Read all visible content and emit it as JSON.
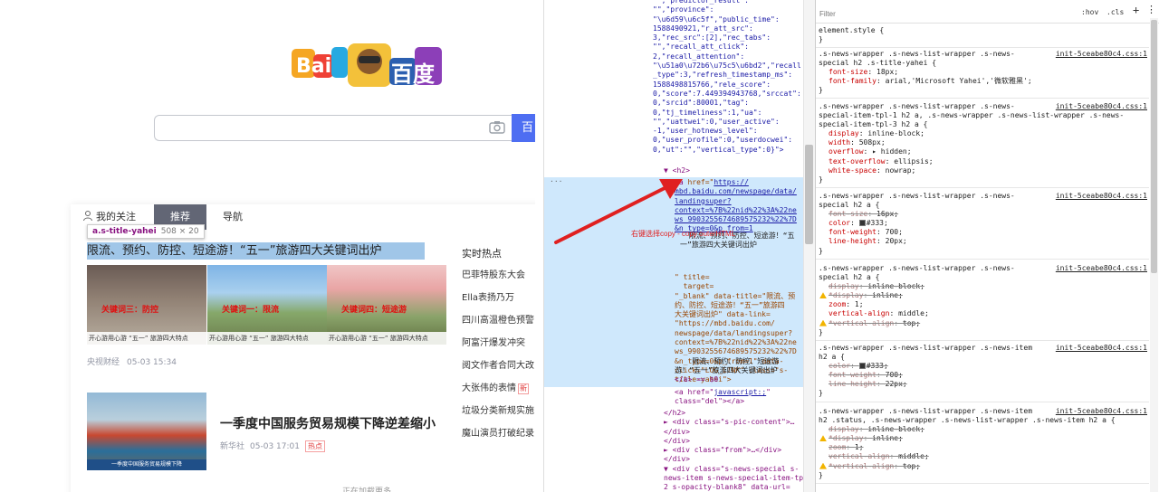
{
  "page": {
    "logo_text": "百度",
    "logo_prefix": "Bai",
    "search": {
      "placeholder": "",
      "button_label": "百"
    },
    "tabs": [
      {
        "label": "我的关注"
      },
      {
        "label": "推荐"
      },
      {
        "label": "导航"
      }
    ],
    "inspect_tooltip": {
      "selector": "a.s-title-yahei",
      "size": "508 × 20"
    },
    "news1": {
      "title": "限流、预约、防控、短途游！“五一”旅游四大关键词出炉",
      "thumbs": [
        {
          "caption": "开心游用心游 “五一” 旅游四大特点",
          "overlay": "关键词三：防控"
        },
        {
          "caption": "开心游用心游 “五一” 旅游四大特点",
          "overlay": "关键词一：限流"
        },
        {
          "caption": "开心游用心游 “五一” 旅游四大特点",
          "overlay": "关键词四：短途游"
        }
      ],
      "source": "央视财经",
      "time": "05-03 15:34"
    },
    "news2": {
      "title": "一季度中国服务贸易规模下降逆差缩小",
      "image_caption": "一季度中国服务贸易规模下降",
      "source": "新华社",
      "time": "05-03 17:01",
      "badge": "热点"
    },
    "hot": {
      "title": "实时热点",
      "items": [
        {
          "label": "巴菲特股东大会",
          "tag": ""
        },
        {
          "label": "Ella表扬乃万",
          "tag": ""
        },
        {
          "label": "四川高温橙色预警",
          "tag": ""
        },
        {
          "label": "阿富汗爆发冲突",
          "tag": ""
        },
        {
          "label": "阅文作者合同大改",
          "tag": ""
        },
        {
          "label": "大张伟的表情",
          "tag": "新"
        },
        {
          "label": "垃圾分类新规实施",
          "tag": ""
        },
        {
          "label": "魔山演员打破纪录",
          "tag": ""
        }
      ]
    },
    "bottom_more": "正在加载更多"
  },
  "elements": {
    "json_top": "  ,\"predictor_result\":\n\"\",\"province\":\n\"\\u6d59\\u6c5f\",\"public_time\":\n1588490921,\"r_att_src\":\n3,\"rec_src\":[2],\"rec_tabs\":\n\"\",\"recall_att_click\":\n2,\"recall_attention\":\n\"\\u51a0\\u72b6\\u75c5\\u6bd2\",\"recall\n_type\":3,\"refresh_timestamp_ms\":\n1588498815766,\"rele_score\":\n0,\"score\":7.449394943768,\"srccat\":\n0,\"srcid\":80001,\"tag\":\n0,\"tj_timeliness\":1,\"ua\":\n\"\",\"uattwei\":0,\"user_active\":\n-1,\"user_hotnews_level\":\n0,\"user_profile\":0,\"userdocwei\":\n0,\"ut\":\"\",\"vertical_type\":0}\">",
    "h2_open": "▼ <h2>",
    "dots": "···",
    "a_open": "<a",
    "href_attr": " href=\"",
    "href_url": "https://\nmbd.baidu.com/newspage/data/\nlandingsuper?\ncontext=%7B%22nid%22%3A%22ne\nws_9903255674689575232%22%7D\n&n_type=0&p_from=1",
    "link_text": "  限流、预约、防控、短途游！“五\n一”旅游四大关键词出炉",
    "attr_rest": "\" title=\n  target=\n\"_blank\" data-title=\"限流、预\n约、防控、短途游！“五一”旅游四\n大关键词出炉\" data-link=\n\"https://mbd.baidu.com/\nnewspage/data/landingsuper?\ncontext=%7B%22nid%22%3A%22ne\nws_9903255674689575232%22%7D\n&n_type=0&p_from=1\" data-\nclick=\"LOG_LINK\" class=\"s-\ntitle-yahei\">",
    "a_inner": "    限流、预约、防控、短途游\n游！“五一”旅游四大关键词出炉",
    "a_close": "</a> == $0",
    "a_js_open": "<a href=\"",
    "a_js_url": "javascript:;",
    "a_js_close": "\"\nclass=\"del\"></a>",
    "tree_rest": "</h2>\n► <div class=\"s-pic-content\">…\n</div>\n</div>\n► <div class=\"from\">…</div>\n</div>\n▼ <div class=\"s-news-special s-\nnews-item s-news-special-item-tpl-\n2 s-opacity-blank8\" data-url=",
    "annotation": "右键选择copy - copy outerHTML"
  },
  "styles": {
    "filter_placeholder": "Filter",
    "hov": ":hov",
    "cls": ".cls",
    "plus": "+",
    "more": "⋮",
    "rules": [
      {
        "selector": "element.style {",
        "source": "",
        "props": [],
        "close": "}"
      },
      {
        "selector": ".s-news-wrapper .s-news-list-wrapper .s-news-\nspecial h2 .s-title-yahei {",
        "source": "init-5ceabe80c4.css:1",
        "props": [
          {
            "name": "font-size",
            "value": "18px;",
            "state": "on"
          },
          {
            "name": "font-family",
            "value": "arial,'Microsoft Yahei','微软雅黑';",
            "state": "on"
          }
        ],
        "close": "}"
      },
      {
        "selector": ".s-news-wrapper .s-news-list-wrapper .s-news-\nspecial-item-tpl-1 h2 a, .s-news-wrapper .s-news-list-wrapper .s-news-\nspecial-item-tpl-3 h2 a {",
        "source": "init-5ceabe80c4.css:1",
        "props": [
          {
            "name": "display",
            "value": "inline-block;",
            "state": "on"
          },
          {
            "name": "width",
            "value": "508px;",
            "state": "on"
          },
          {
            "name": "overflow",
            "value": "▸ hidden;",
            "state": "on"
          },
          {
            "name": "text-overflow",
            "value": "ellipsis;",
            "state": "on"
          },
          {
            "name": "white-space",
            "value": "nowrap;",
            "state": "on"
          }
        ],
        "close": "}"
      },
      {
        "selector": ".s-news-wrapper .s-news-list-wrapper .s-news-\nspecial h2 a {",
        "source": "init-5ceabe80c4.css:1",
        "props": [
          {
            "name": "font-size",
            "value": "16px;",
            "state": "off"
          },
          {
            "name": "color",
            "value": "#333;",
            "state": "on",
            "swatch": "#333333"
          },
          {
            "name": "font-weight",
            "value": "700;",
            "state": "on"
          },
          {
            "name": "line-height",
            "value": "20px;",
            "state": "on"
          }
        ],
        "close": "}"
      },
      {
        "selector": ".s-news-wrapper .s-news-list-wrapper .s-news-\nspecial h2 a {",
        "source": "init-5ceabe80c4.css:1",
        "props": [
          {
            "name": "display",
            "value": "inline-block;",
            "state": "off"
          },
          {
            "name": "*display",
            "value": "inline;",
            "state": "warn"
          },
          {
            "name": "zoom",
            "value": "1;",
            "state": "on"
          },
          {
            "name": "vertical-align",
            "value": "middle;",
            "state": "on"
          },
          {
            "name": "*vertical-align",
            "value": "top;",
            "state": "warn"
          }
        ],
        "close": "}"
      },
      {
        "selector": ".s-news-wrapper .s-news-list-wrapper .s-news-item\nh2 a {",
        "source": "init-5ceabe80c4.css:1",
        "props": [
          {
            "name": "color",
            "value": "#333;",
            "state": "off",
            "swatch": "#333333"
          },
          {
            "name": "font-weight",
            "value": "700;",
            "state": "off"
          },
          {
            "name": "line-height",
            "value": "22px;",
            "state": "off"
          }
        ],
        "close": "}"
      },
      {
        "selector": ".s-news-wrapper .s-news-list-wrapper .s-news-item\nh2 .status, .s-news-wrapper .s-news-list-wrapper .s-news-item h2 a {",
        "source": "init-5ceabe80c4.css:1",
        "props": [
          {
            "name": "display",
            "value": "inline-block;",
            "state": "off"
          },
          {
            "name": "*display",
            "value": "inline;",
            "state": "warn"
          },
          {
            "name": "zoom",
            "value": "1;",
            "state": "off"
          },
          {
            "name": "vertical-align",
            "value": "middle;",
            "state": "off"
          },
          {
            "name": "*vertical-align",
            "value": "top;",
            "state": "warn"
          }
        ],
        "close": "}"
      }
    ]
  },
  "colors": {
    "accent": "#4e6ef2",
    "highlight": "#cfe8fc",
    "arrow": "#e02020"
  }
}
